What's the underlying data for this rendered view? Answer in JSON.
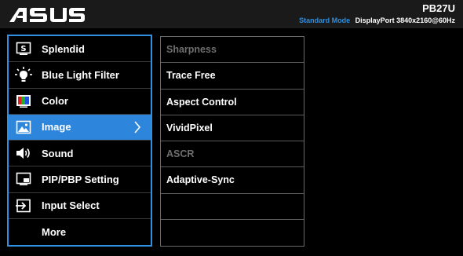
{
  "header": {
    "logo_text": "/ISUS",
    "model": "PB27U",
    "mode": "Standard Mode",
    "port_resolution": "DisplayPort  3840x2160@60Hz"
  },
  "main_menu": {
    "items": [
      {
        "label": "Splendid",
        "icon": "splendid-icon"
      },
      {
        "label": "Blue Light Filter",
        "icon": "bulb-icon"
      },
      {
        "label": "Color",
        "icon": "color-icon"
      },
      {
        "label": "Image",
        "icon": "image-icon",
        "active": true
      },
      {
        "label": "Sound",
        "icon": "speaker-icon"
      },
      {
        "label": "PIP/PBP Setting",
        "icon": "pip-icon"
      },
      {
        "label": "Input Select",
        "icon": "input-icon"
      },
      {
        "label": "More",
        "icon": ""
      }
    ]
  },
  "sub_menu": {
    "items": [
      {
        "label": "Sharpness",
        "enabled": false
      },
      {
        "label": "Trace Free",
        "enabled": true
      },
      {
        "label": "Aspect Control",
        "enabled": true
      },
      {
        "label": "VividPixel",
        "enabled": true
      },
      {
        "label": "ASCR",
        "enabled": false
      },
      {
        "label": "Adaptive-Sync",
        "enabled": true
      },
      {
        "label": "",
        "enabled": false
      },
      {
        "label": "",
        "enabled": false
      }
    ]
  },
  "colors": {
    "accent": "#2f8fe0",
    "active_bg": "#2e86dc",
    "disabled_text": "#6e6e6e"
  }
}
